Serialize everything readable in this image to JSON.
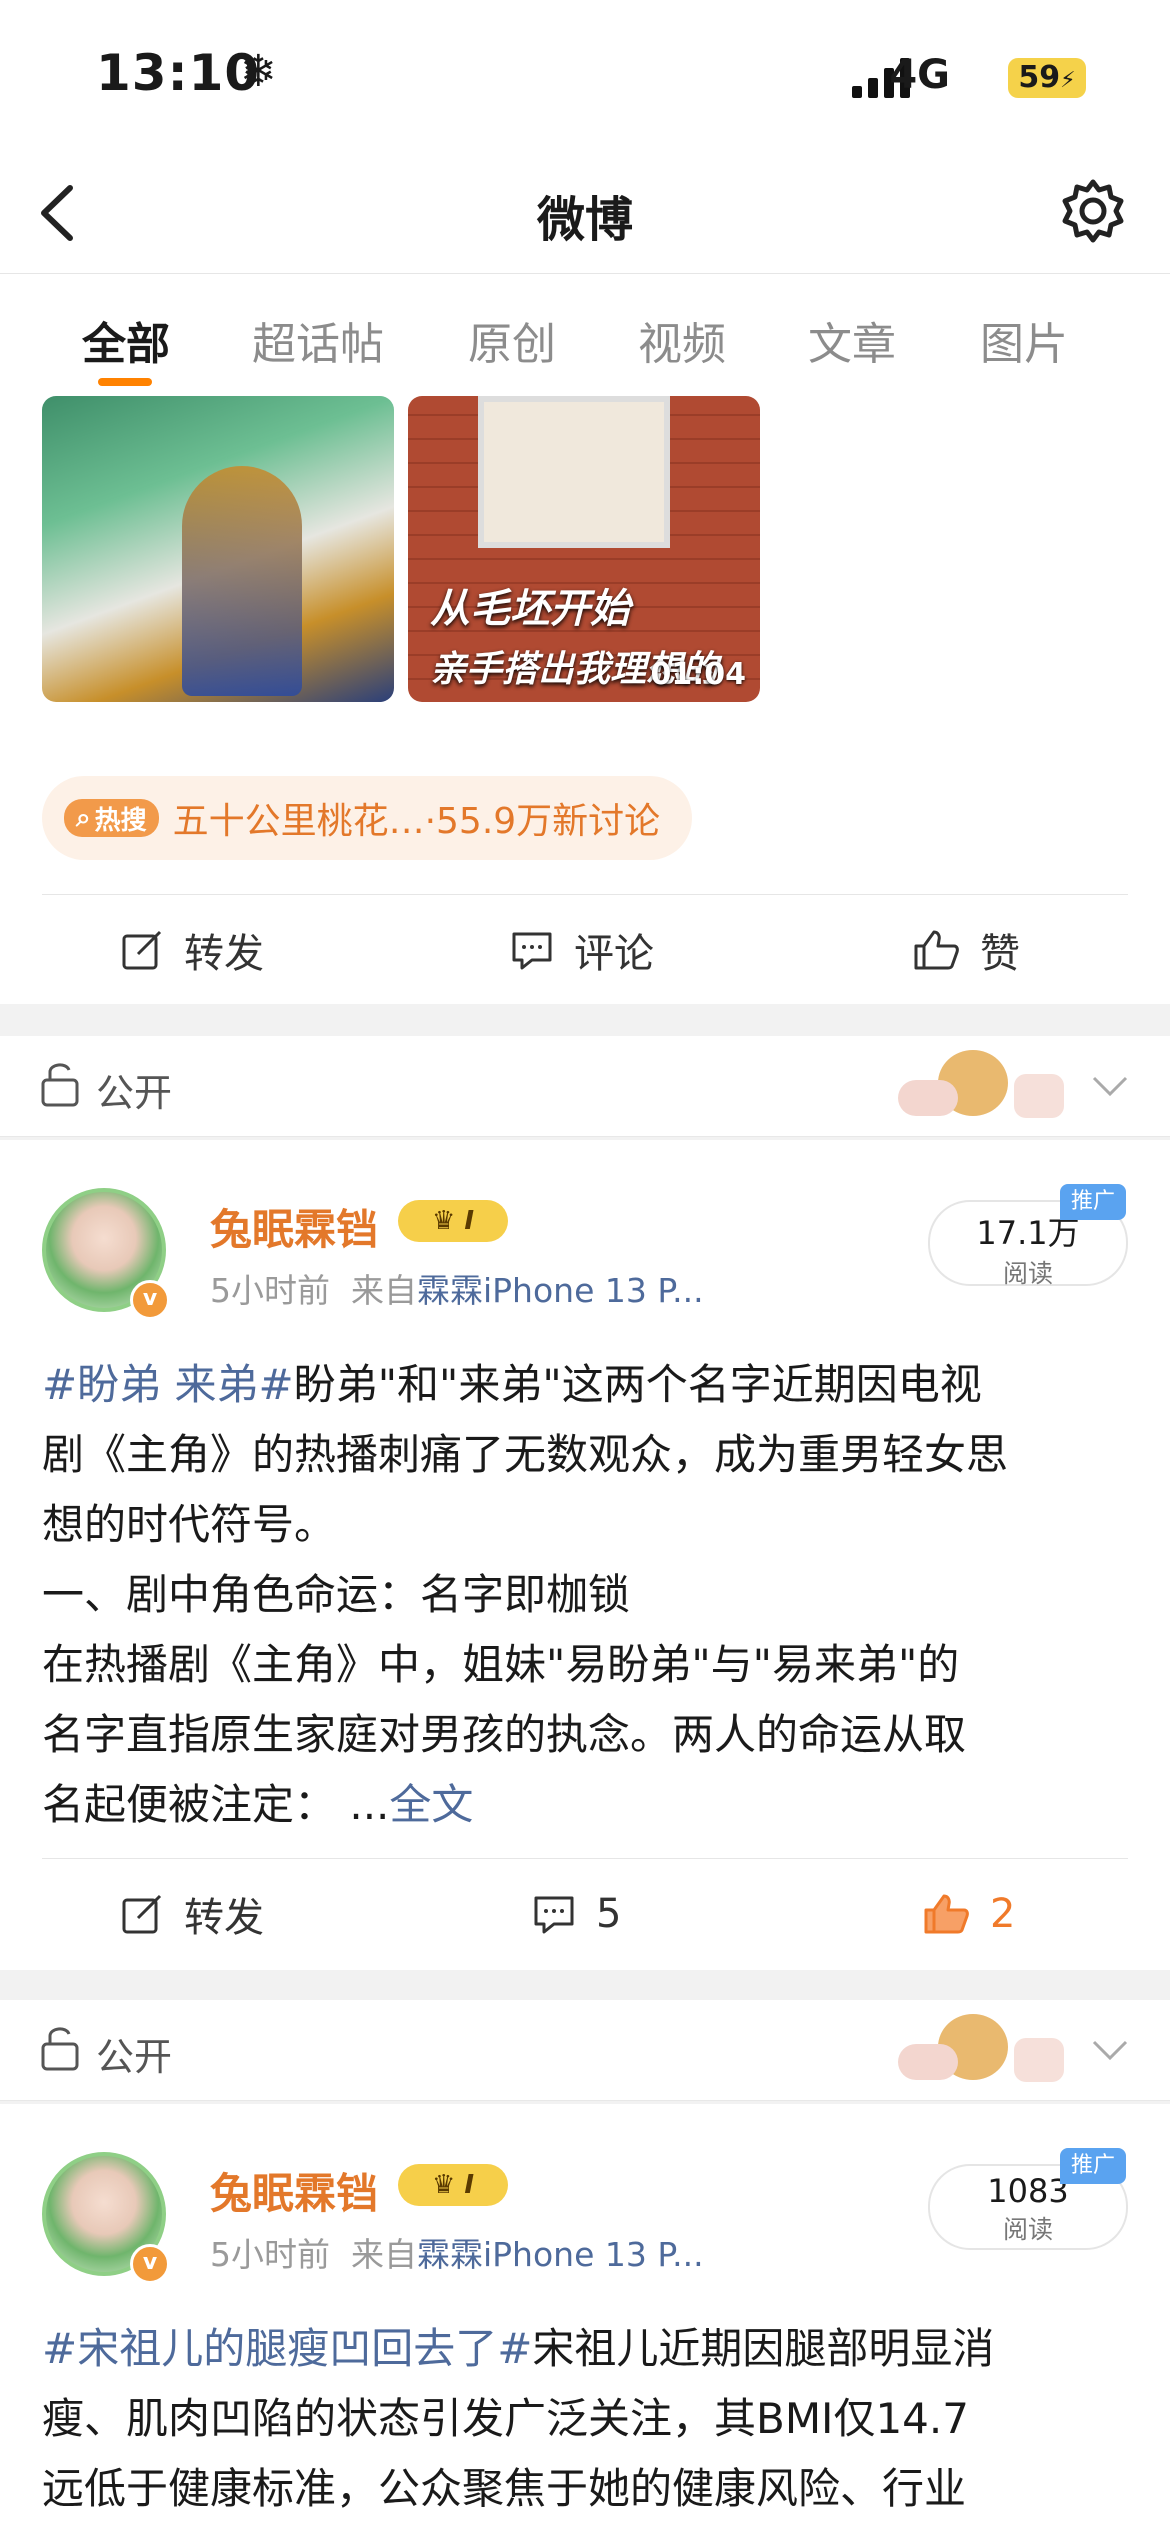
{
  "status_bar": {
    "time": "13:10",
    "network": "4G",
    "battery": "59"
  },
  "nav": {
    "title": "微博"
  },
  "tabs": [
    {
      "label": "全部",
      "active": true
    },
    {
      "label": "超话帖"
    },
    {
      "label": "原创"
    },
    {
      "label": "视频"
    },
    {
      "label": "文章"
    },
    {
      "label": "图片"
    }
  ],
  "prev_post": {
    "video_duration": "01:04",
    "thumb_text_1": "从毛坯开始",
    "thumb_text_2": "亲手搭出我理想的",
    "hot_badge": "热搜",
    "hot_text": "五十公里桃花…·55.9万新讨论",
    "actions": {
      "repost": "转发",
      "comment": "评论",
      "like": "赞"
    }
  },
  "posts": [
    {
      "visibility": "公开",
      "username": "兔眠霖铛",
      "level": "I",
      "time": "5小时前",
      "from_prefix": "来自",
      "source": "霖霖iPhone 13 P...",
      "reads": "17.1万",
      "reads_unit": "阅读",
      "promo": "推广",
      "tag": "#盼弟 来弟#",
      "lines": [
        "盼弟\"和\"来弟\"这两个名字近期因电视",
        "剧《主角》的热播刺痛了无数观众，成为重男轻女思",
        "想的时代符号。",
        "一、剧中角色命运：名字即枷锁",
        "在热播剧《主角》中，姐妹\"易盼弟\"与\"易来弟\"的",
        "名字直指原生家庭对男孩的执念。两人的命运从取",
        "名起便被注定：  ..."
      ],
      "more": "全文",
      "actions": {
        "repost": "转发",
        "comment": "5",
        "like": "2"
      }
    },
    {
      "visibility": "公开",
      "username": "兔眠霖铛",
      "level": "I",
      "time": "5小时前",
      "from_prefix": "来自",
      "source": "霖霖iPhone 13 P...",
      "reads": "1083",
      "reads_unit": "阅读",
      "promo": "推广",
      "tag": "#宋祖儿的腿瘦凹回去了#",
      "lines": [
        "宋祖儿近期因腿部明显消",
        "瘦、肌肉凹陷的状态引发广泛关注，其BMI仅14.7",
        "远低于健康标准，公众聚焦于她的健康风险、行业"
      ]
    }
  ],
  "colors": {
    "accent": "#ff8200",
    "link": "#4e6a9b",
    "name": "#e3782a",
    "like_active": "#f07a2a"
  }
}
